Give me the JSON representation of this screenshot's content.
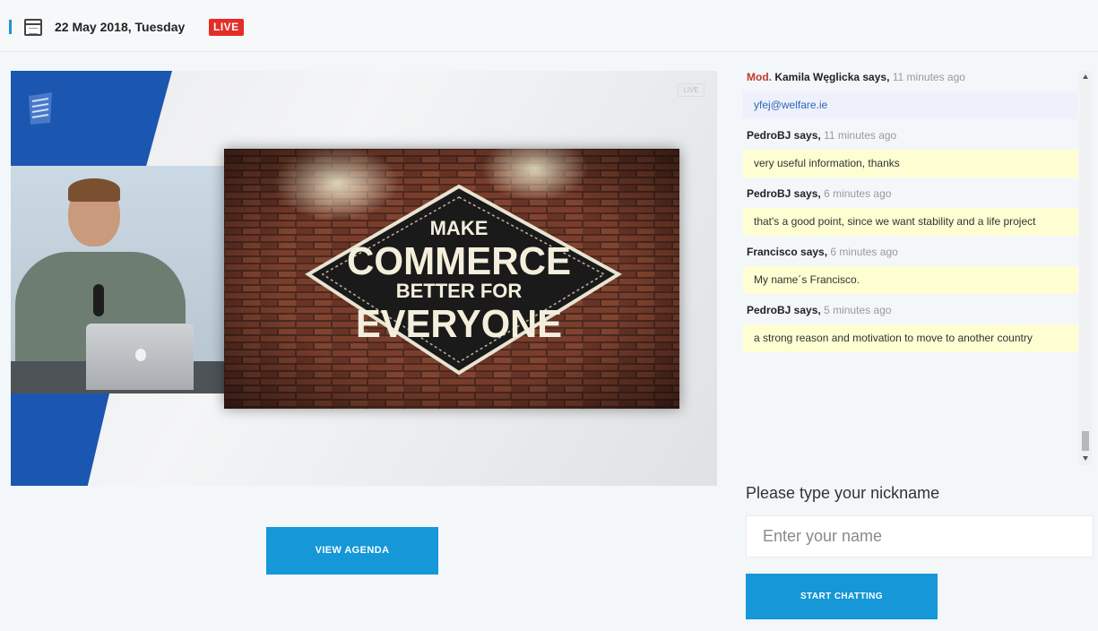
{
  "header": {
    "date": "22 May 2018, Tuesday",
    "live_badge": "LIVE",
    "accent": "#1597d8",
    "live_color": "#e52d27"
  },
  "video": {
    "slide_lines": [
      "MAKE",
      "COMMERCE",
      "BETTER FOR",
      "EVERYONE"
    ],
    "live_mark": "LIVE"
  },
  "agenda_button": {
    "label": "VIEW AGENDA"
  },
  "chat": {
    "messages": [
      {
        "role": "Mod.",
        "author": "Kamila Węglicka says,",
        "time": "11 minutes ago",
        "text": "yfej@welfare.ie"
      },
      {
        "role": "",
        "author": "PedroBJ says,",
        "time": "11 minutes ago",
        "text": "very useful information, thanks"
      },
      {
        "role": "",
        "author": "PedroBJ says,",
        "time": "6 minutes ago",
        "text": "that's a good point, since we want stability and a life project"
      },
      {
        "role": "",
        "author": "Francisco says,",
        "time": "6 minutes ago",
        "text": "My name´s Francisco."
      },
      {
        "role": "",
        "author": "PedroBJ says,",
        "time": "5 minutes ago",
        "text": "a strong reason and motivation to move to another country"
      }
    ],
    "nickname_label": "Please type your nickname",
    "name_placeholder": "Enter your name",
    "start_label": "START CHATTING"
  }
}
